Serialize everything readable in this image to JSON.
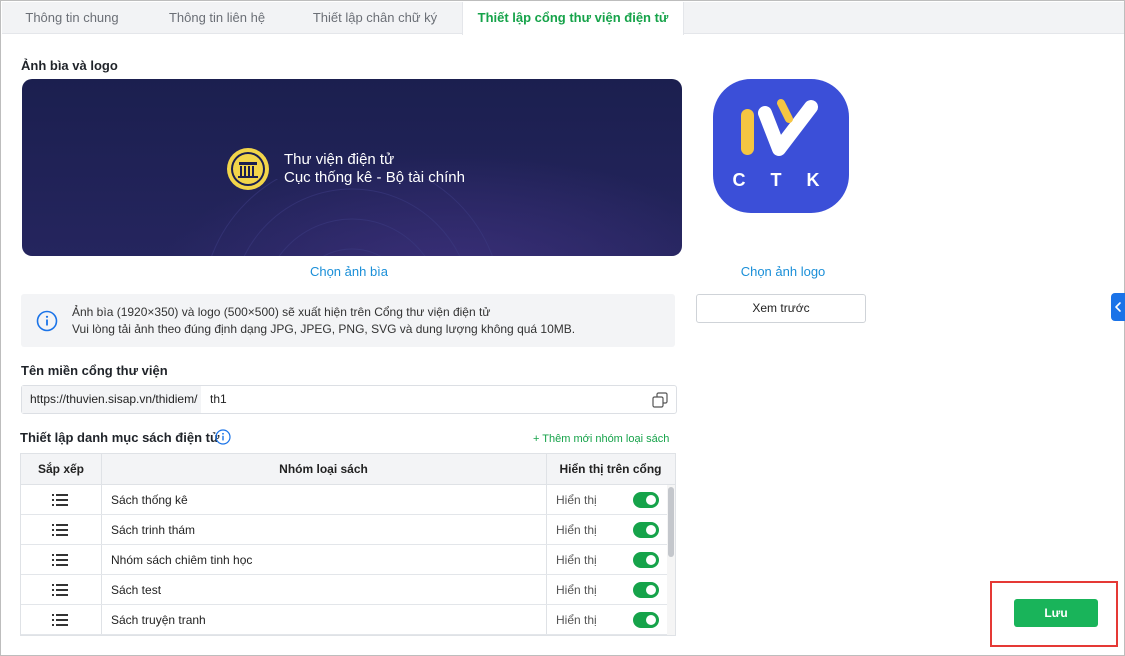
{
  "tabs": [
    {
      "label": "Thông tin chung"
    },
    {
      "label": "Thông tin liên hệ"
    },
    {
      "label": "Thiết lập chân chữ ký"
    },
    {
      "label": "Thiết lập cổng thư viện điện tử",
      "active": true
    }
  ],
  "cover_section": {
    "title": "Ảnh bìa và logo",
    "cover_text_line1": "Thư viện điện tử",
    "cover_text_line2": "Cục thống kê - Bộ tài chính",
    "choose_cover_label": "Chọn ảnh bìa",
    "logo_text": "C T K",
    "choose_logo_label": "Chọn ảnh logo"
  },
  "info": {
    "line1": "Ảnh bìa (1920×350) và logo (500×500) sẽ xuất hiện trên Cổng thư viện điện tử",
    "line2": "Vui lòng tải ảnh theo đúng định dạng JPG, JPEG, PNG, SVG và dung lượng không quá 10MB."
  },
  "preview_button": "Xem trước",
  "domain": {
    "title": "Tên miền cổng thư viện",
    "prefix": "https://thuvien.sisap.vn/thidiem/",
    "value": "th1"
  },
  "catalog": {
    "title": "Thiết lập danh mục sách điện tử",
    "add_label": "+ Thêm mới nhóm loại sách",
    "headers": {
      "sort": "Sắp xếp",
      "group": "Nhóm loại sách",
      "display": "Hiển thị trên cổng"
    },
    "rows": [
      {
        "name": "Sách thống kê",
        "display": "Hiển thị",
        "enabled": true
      },
      {
        "name": "Sách trinh thám",
        "display": "Hiển thị",
        "enabled": true
      },
      {
        "name": "Nhóm sách chiêm tinh học",
        "display": "Hiển thị",
        "enabled": true
      },
      {
        "name": "Sách test",
        "display": "Hiển thị",
        "enabled": true
      },
      {
        "name": "Sách truyện tranh",
        "display": "Hiển thị",
        "enabled": true
      }
    ]
  },
  "save_button": "Lưu",
  "colors": {
    "accent_green": "#16a34a",
    "link_blue": "#1a8fd8",
    "logo_blue": "#3b4fd8",
    "logo_yellow": "#f5c542",
    "highlight_red": "#e53935"
  }
}
